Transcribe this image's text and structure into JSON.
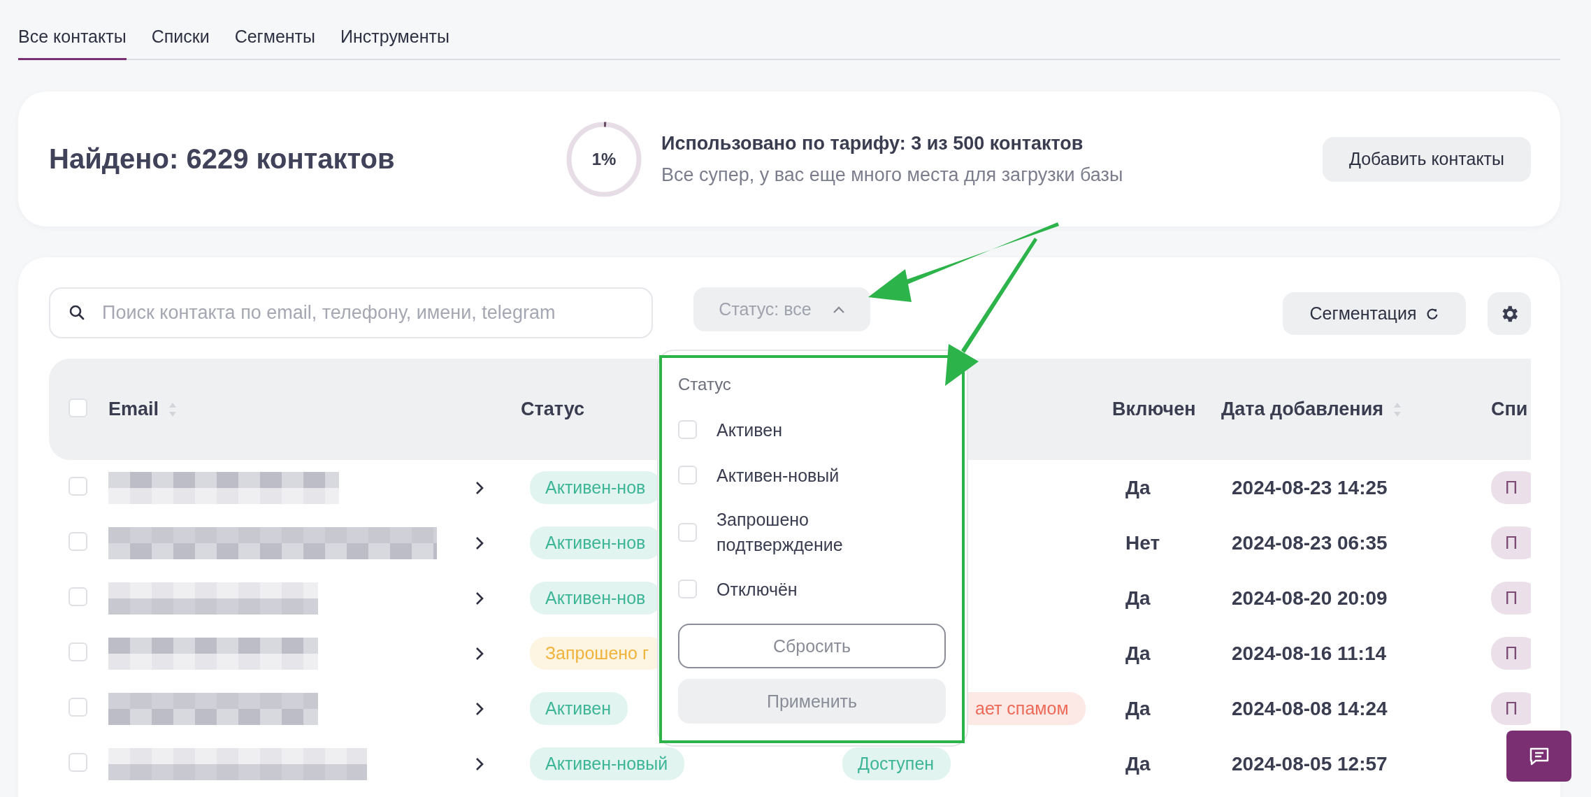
{
  "tabs": [
    {
      "label": "Все контакты",
      "selected": true
    },
    {
      "label": "Списки",
      "selected": false
    },
    {
      "label": "Сегменты",
      "selected": false
    },
    {
      "label": "Инструменты",
      "selected": false
    }
  ],
  "summary": {
    "found": "Найдено: 6229 контактов",
    "usage": {
      "percent": "1%",
      "level": 0.01,
      "title": "Использовано по тарифу: 3 из 500 контактов",
      "subtitle": "Все супер, у вас еще много места для загрузки базы"
    },
    "add_button": "Добавить контакты"
  },
  "toolbar": {
    "search": {
      "placeholder": "Поиск контакта по email, телефону, имени, telegram"
    },
    "status_filter": {
      "label": "Статус: все",
      "expanded": true
    },
    "segmentation_button": "Сегментация"
  },
  "table": {
    "all_checked": false,
    "columns": [
      {
        "label": "Email",
        "sortable": true
      },
      {
        "label": "Статус",
        "sortable": false
      },
      {
        "label": "Включен",
        "sortable": false
      },
      {
        "label": "Дата добавления",
        "sortable": true
      },
      {
        "label": "Спи"
      }
    ],
    "rows": [
      {
        "checked": false,
        "status": {
          "label": "Активен-нов",
          "color": "#3db597"
        },
        "enabled": "Да",
        "date": "2024-08-23 14:25",
        "list_tag": "П"
      },
      {
        "checked": false,
        "status": {
          "label": "Активен-нов",
          "color": "#3db597"
        },
        "enabled": "Нет",
        "date": "2024-08-23 06:35",
        "list_tag": "П"
      },
      {
        "checked": false,
        "status": {
          "label": "Активен-нов",
          "color": "#3db597"
        },
        "enabled": "Да",
        "date": "2024-08-20 20:09",
        "list_tag": "П"
      },
      {
        "checked": false,
        "status": {
          "label": "Запрошено г",
          "color": "#f0b43c"
        },
        "enabled": "Да",
        "date": "2024-08-16 11:14",
        "list_tag": "П"
      },
      {
        "checked": false,
        "status": {
          "label": "Активен",
          "color": "#3db597"
        },
        "status_2": {
          "label": "ает спамом",
          "color": "#ee6a58",
          "truncated_left": true
        },
        "enabled": "Да",
        "date": "2024-08-08 14:24",
        "list_tag": "П"
      },
      {
        "checked": false,
        "status": {
          "label": "Активен-новый",
          "color": "#3db597"
        },
        "status_2": {
          "label": "Доступен",
          "color": "#3db597",
          "truncated_left": false
        },
        "enabled": "Да",
        "date": "2024-08-05 12:57"
      }
    ]
  },
  "status_dropdown": {
    "title": "Статус",
    "options": [
      {
        "label": "Активен",
        "checked": false
      },
      {
        "label": "Активен-новый",
        "checked": false
      },
      {
        "label": "Запрошено подтверждение",
        "checked": false
      },
      {
        "label": "Отключён",
        "checked": false
      }
    ],
    "reset_button": "Сбросить",
    "apply_button": "Применить"
  }
}
